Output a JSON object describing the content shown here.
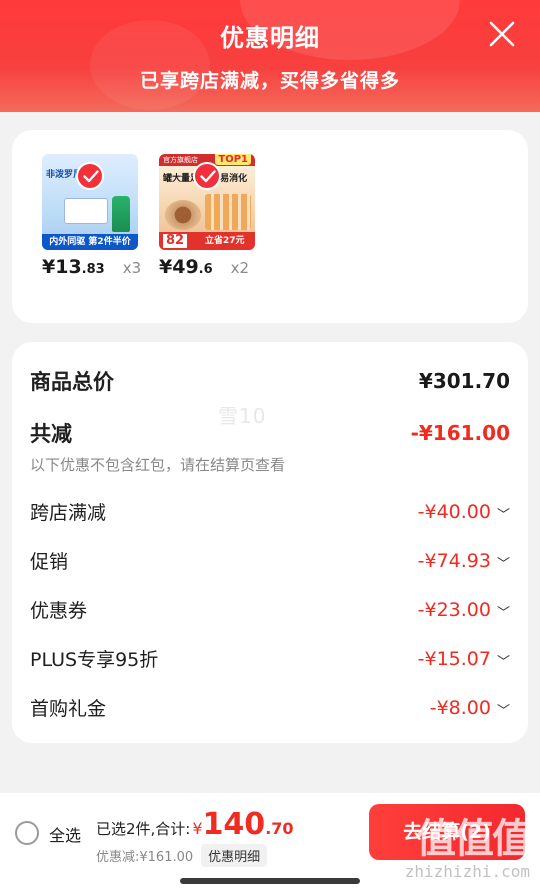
{
  "header": {
    "title": "优惠明细",
    "subtitle": "已享跨店满减，买得多省得多"
  },
  "products": [
    {
      "price_int": "¥13",
      "price_dec": ".83",
      "qty": "x3",
      "thumb_brand": "非泼罗尼",
      "thumb_banner": "内外同驱 第2件半价"
    },
    {
      "price_int": "¥49",
      "price_dec": ".6",
      "qty": "x2",
      "thumb_top": "官方旗舰店",
      "thumb_top1": "TOP1",
      "thumb_text": "罐大量足 营养易消化",
      "thumb_num": "82",
      "thumb_banner": "立省27元"
    }
  ],
  "summary": {
    "total_label": "商品总价",
    "total_value": "¥301.70",
    "reduce_label": "共减",
    "reduce_value": "-¥161.00",
    "note": "以下优惠不包含红包，请在结算页查看",
    "watermark": "雪10",
    "items": [
      {
        "label": "跨店满减",
        "value": "-¥40.00"
      },
      {
        "label": "促销",
        "value": "-¥74.93"
      },
      {
        "label": "优惠券",
        "value": "-¥23.00"
      },
      {
        "label": "PLUS专享95折",
        "value": "-¥15.07"
      },
      {
        "label": "首购礼金",
        "value": "-¥8.00"
      }
    ]
  },
  "bottom": {
    "select_all": "全选",
    "selected_text": "已选2件,合计:",
    "yen": "¥",
    "amount": "140",
    "amount_dec": ".70",
    "discount": "优惠减:¥161.00",
    "detail_button": "优惠明细",
    "checkout": "去结算(2)",
    "site_logo": "值值值",
    "site_watermark": "zhizhizhi.com"
  },
  "colors": {
    "accent": "#f2303b",
    "price_red": "#ef2b22"
  }
}
